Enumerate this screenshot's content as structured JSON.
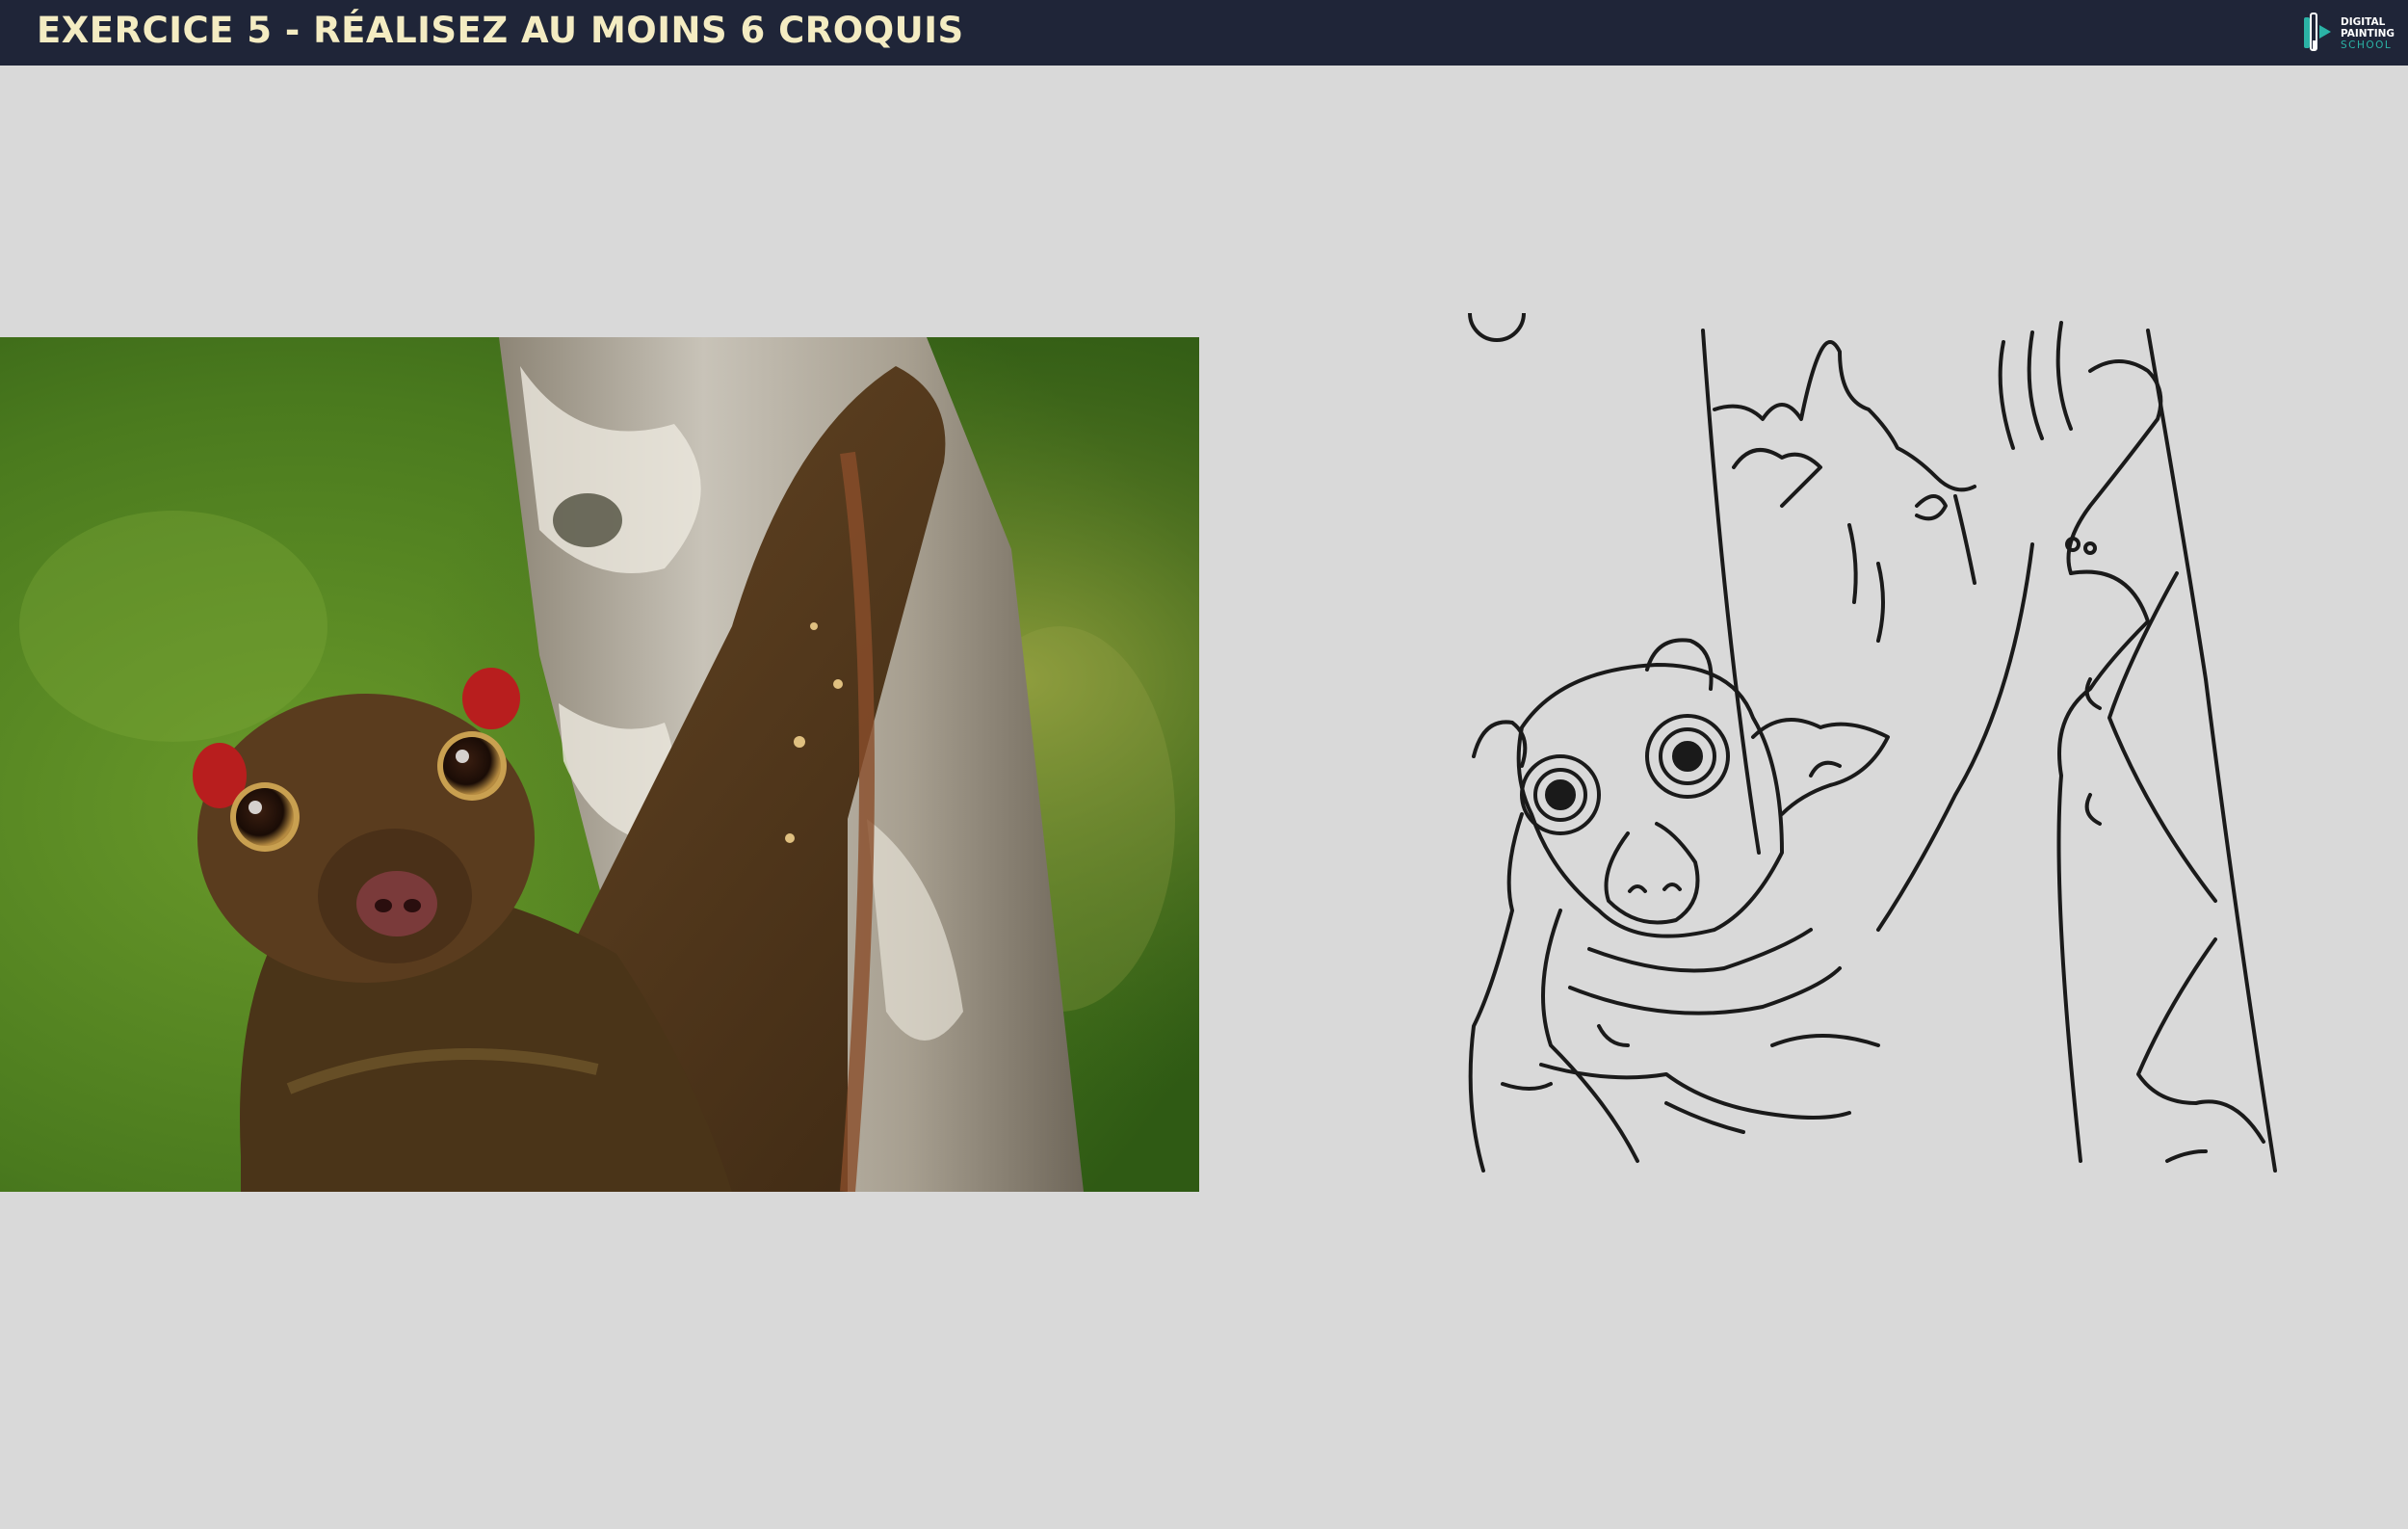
{
  "header": {
    "title": "EXERCICE 5 - RÉALISEZ AU MOINS 6 CROQUIS",
    "logo": {
      "line1": "DIGITAL",
      "line2": "PAINTING",
      "line3": "SCHOOL",
      "icon": "brush-logo-icon"
    }
  },
  "colors": {
    "header_bg": "#1f2538",
    "title": "#f4ecc2",
    "canvas_bg": "#d9d9d9",
    "logo_accent": "#2bb3a6"
  },
  "reference_photo": {
    "subject": "colugo-on-tree"
  },
  "sketch": {
    "style": "line-drawing"
  }
}
